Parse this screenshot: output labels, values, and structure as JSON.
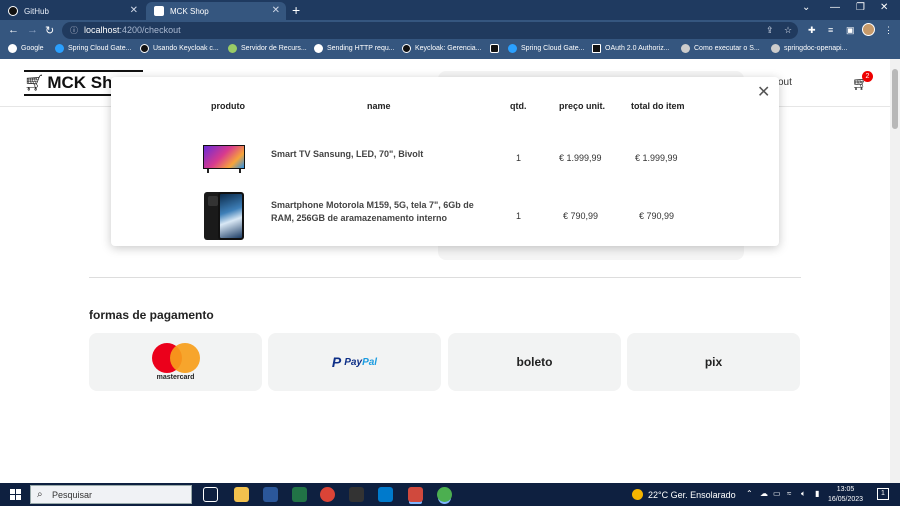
{
  "browser": {
    "tabs": [
      {
        "label": "GitHub",
        "active": false
      },
      {
        "label": "MCK Shop",
        "active": true
      }
    ],
    "url_host": "localhost",
    "url_path": ":4200/checkout",
    "bookmarks": [
      "Google",
      "Spring Cloud Gate...",
      "Usando Keycloak c...",
      "Servidor de Recurs...",
      "Sending HTTP requ...",
      "Keycloak: Gerencia...",
      "",
      "Spring Cloud Gate...",
      "OAuth 2.0 Authoriz...",
      "Como executar o S...",
      "springdoc-openapi..."
    ]
  },
  "header": {
    "logo": "MCK Shop",
    "partial_nav": "out",
    "cart_count": "2"
  },
  "modal": {
    "columns": [
      "produto",
      "name",
      "qtd.",
      "preço unit.",
      "total do item"
    ],
    "items": [
      {
        "name_line1": "Smart TV Sansung, LED, 70\", Bivolt",
        "name_line2": "",
        "qty": "1",
        "unit_price": "€ 1.999,99",
        "total": "€ 1.999,99"
      },
      {
        "name_line1": "Smartphone Motorola M159, 5G, tela 7\", 6Gb de",
        "name_line2": "RAM, 256GB de aramazenamento interno",
        "qty": "1",
        "unit_price": "€ 790,99",
        "total": "€ 790,99"
      }
    ]
  },
  "payment": {
    "title": "formas de pagamento",
    "methods": {
      "mastercard": "mastercard",
      "paypal_pay": "Pay",
      "paypal_pal": "Pal",
      "boleto": "boleto",
      "pix": "pix"
    }
  },
  "taskbar": {
    "search_placeholder": "Pesquisar",
    "weather": "22°C  Ger. Ensolarado",
    "time": "13:05",
    "date": "16/05/2023",
    "notification_count": "1"
  },
  "colors": {
    "browser_chrome": "#35567f",
    "tab_strip": "#1f3a60",
    "cart_badge": "#e00000",
    "paypal_dark": "#0e2f87",
    "paypal_light": "#1a9be0",
    "mastercard_red": "#eb001b",
    "mastercard_orange": "#f79e1b"
  }
}
